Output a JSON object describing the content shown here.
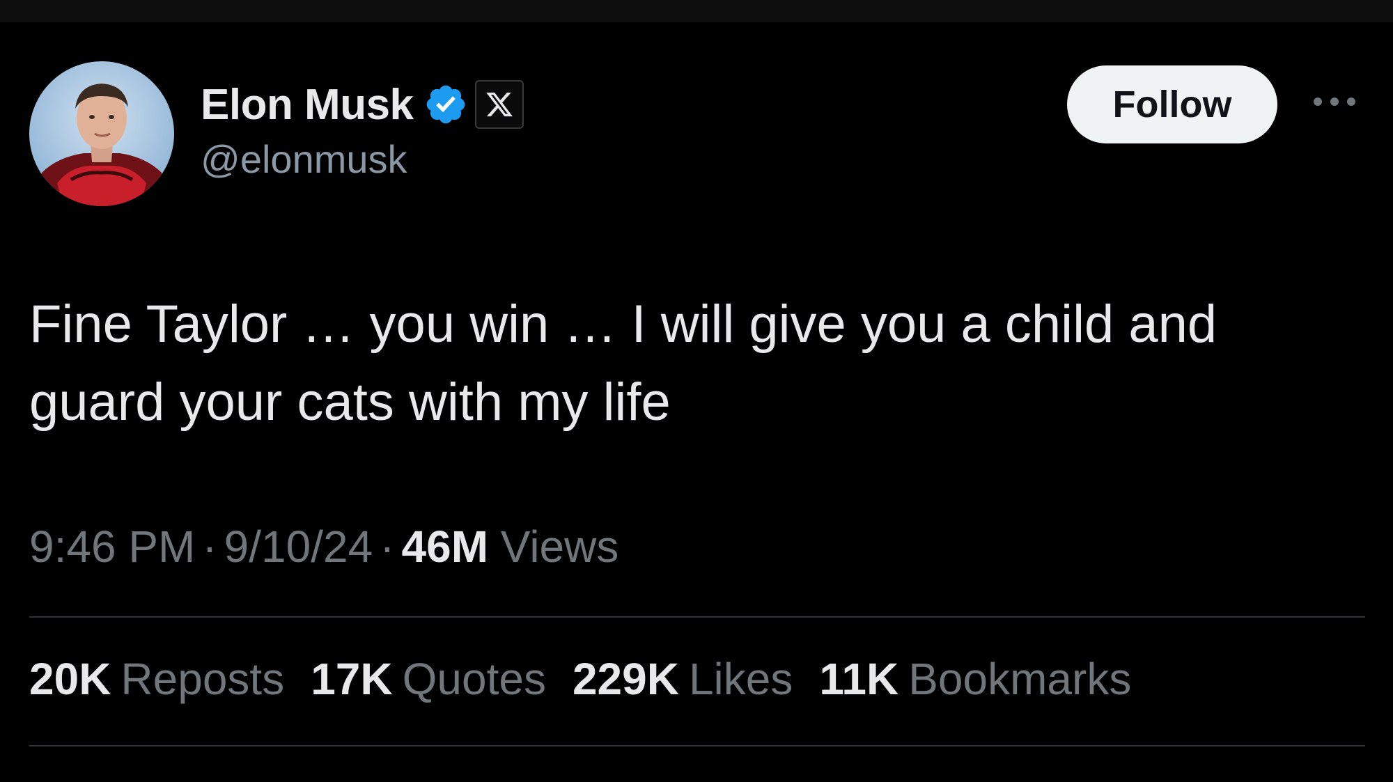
{
  "author": {
    "display_name": "Elon Musk",
    "handle": "@elonmusk",
    "verified_badge_color": "#1d9bf0",
    "affiliation_icon": "x-logo-icon"
  },
  "follow_button": {
    "label": "Follow"
  },
  "more_menu_icon": "more-horizontal-icon",
  "tweet": {
    "text_lines": [
      "Fine Taylor … you win … I will give you a child and",
      "guard your cats with my life"
    ]
  },
  "meta": {
    "time": "9:46 PM",
    "date": "9/10/24",
    "separator": "·",
    "views_count": "46M",
    "views_label": "Views"
  },
  "stats": [
    {
      "count": "20K",
      "label": "Reposts"
    },
    {
      "count": "17K",
      "label": "Quotes"
    },
    {
      "count": "229K",
      "label": "Likes"
    },
    {
      "count": "11K",
      "label": "Bookmarks"
    }
  ],
  "colors": {
    "background": "#000000",
    "primary_text": "#e7e9ea",
    "secondary_text": "#71767b",
    "divider": "#2f3336",
    "follow_bg": "#eff3f4"
  }
}
